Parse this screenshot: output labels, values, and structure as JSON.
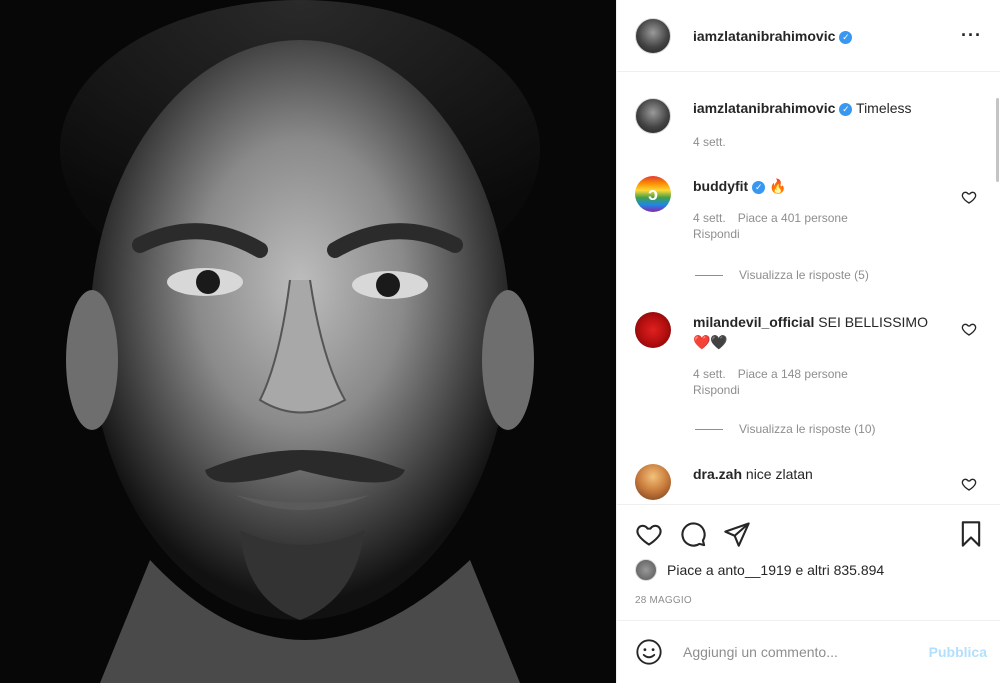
{
  "post": {
    "photo_alt": "Portrait",
    "author": "iamzlatanibrahimovic",
    "caption": "Timeless",
    "caption_time": "4 sett.",
    "more_icon": "more-options-icon"
  },
  "comments": [
    {
      "username": "buddyfit",
      "text": "🔥",
      "verified": true,
      "time": "4 sett.",
      "likes": "Piace a 401 persone",
      "reply": "Rispondi",
      "view_replies": "Visualizza le risposte (5)"
    },
    {
      "username": "milandevil_official",
      "text": "SEI BELLISSIMO❤️🖤",
      "verified": false,
      "time": "4 sett.",
      "likes": "Piace a 148 persone",
      "reply": "Rispondi",
      "view_replies": "Visualizza le risposte (10)"
    },
    {
      "username": "dra.zah",
      "text": "nice zlatan",
      "verified": false
    }
  ],
  "actions": {
    "icons": [
      "heart-icon",
      "comment-icon",
      "share-icon",
      "bookmark-icon"
    ],
    "likes_text": "Piace a anto__1919 e altri 835.894",
    "date": "28 MAGGIO"
  },
  "composer": {
    "placeholder": "Aggiungi un commento...",
    "publish_label": "Pubblica"
  },
  "colors": {
    "verified": "#3897f0",
    "publish_disabled": "#b2dffc",
    "secondary_text": "#8e8e8e"
  }
}
